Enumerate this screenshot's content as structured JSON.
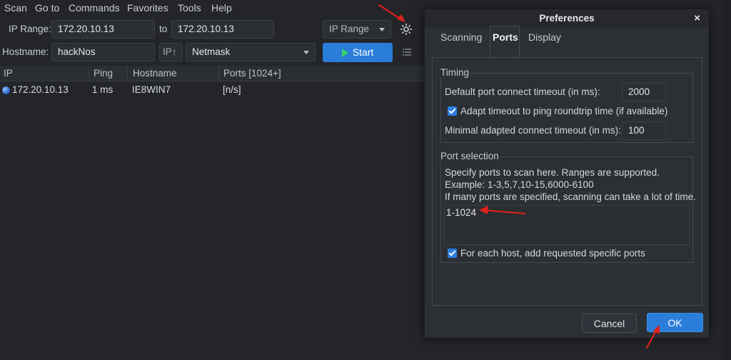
{
  "menu": [
    "Scan",
    "Go to",
    "Commands",
    "Favorites",
    "Tools",
    "Help"
  ],
  "toolbar": {
    "ip_range_label": "IP Range:",
    "ip_start": "172.20.10.13",
    "to_label": "to",
    "ip_end": "172.20.10.13",
    "feeder_select": "IP Range",
    "hostname_label": "Hostname:",
    "hostname_value": "hackNos",
    "ip_up_button": "IP↑",
    "netmask_select": "Netmask",
    "start_button": "Start"
  },
  "table": {
    "headers": [
      "IP",
      "Ping",
      "Hostname",
      "Ports [1024+]"
    ],
    "rows": [
      {
        "ip": "172.20.10.13",
        "ping": "1 ms",
        "hostname": "IE8WIN7",
        "ports": "[n/s]"
      }
    ]
  },
  "dialog": {
    "title": "Preferences",
    "close": "×",
    "tabs": [
      "Scanning",
      "Ports",
      "Display"
    ],
    "active_tab": "Ports",
    "timing": {
      "title": "Timing",
      "connect_timeout_label": "Default port connect timeout (in ms):",
      "connect_timeout_value": "2000",
      "adapt_label": "Adapt timeout to ping roundtrip time (if available)",
      "adapt_checked": true,
      "min_timeout_label": "Minimal adapted connect timeout (in ms):",
      "min_timeout_value": "100"
    },
    "port_selection": {
      "title": "Port selection",
      "help_line1": "Specify ports to scan here. Ranges are supported.",
      "help_line2": "Example: 1-3,5,7,10-15,6000-6100",
      "help_line3": "If many ports are specified, scanning can take a lot of time.",
      "ports_value": "1-1024",
      "add_specific_label": "For each host, add requested specific ports",
      "add_specific_checked": true
    },
    "cancel_button": "Cancel",
    "ok_button": "OK"
  },
  "colors": {
    "accent": "#2a7dd8",
    "annotation": "#e2221a",
    "background": "#232529"
  },
  "icons": {
    "settings": "gear-icon",
    "start": "play-icon",
    "list": "list-icon",
    "row_status": "host-alive-icon"
  }
}
